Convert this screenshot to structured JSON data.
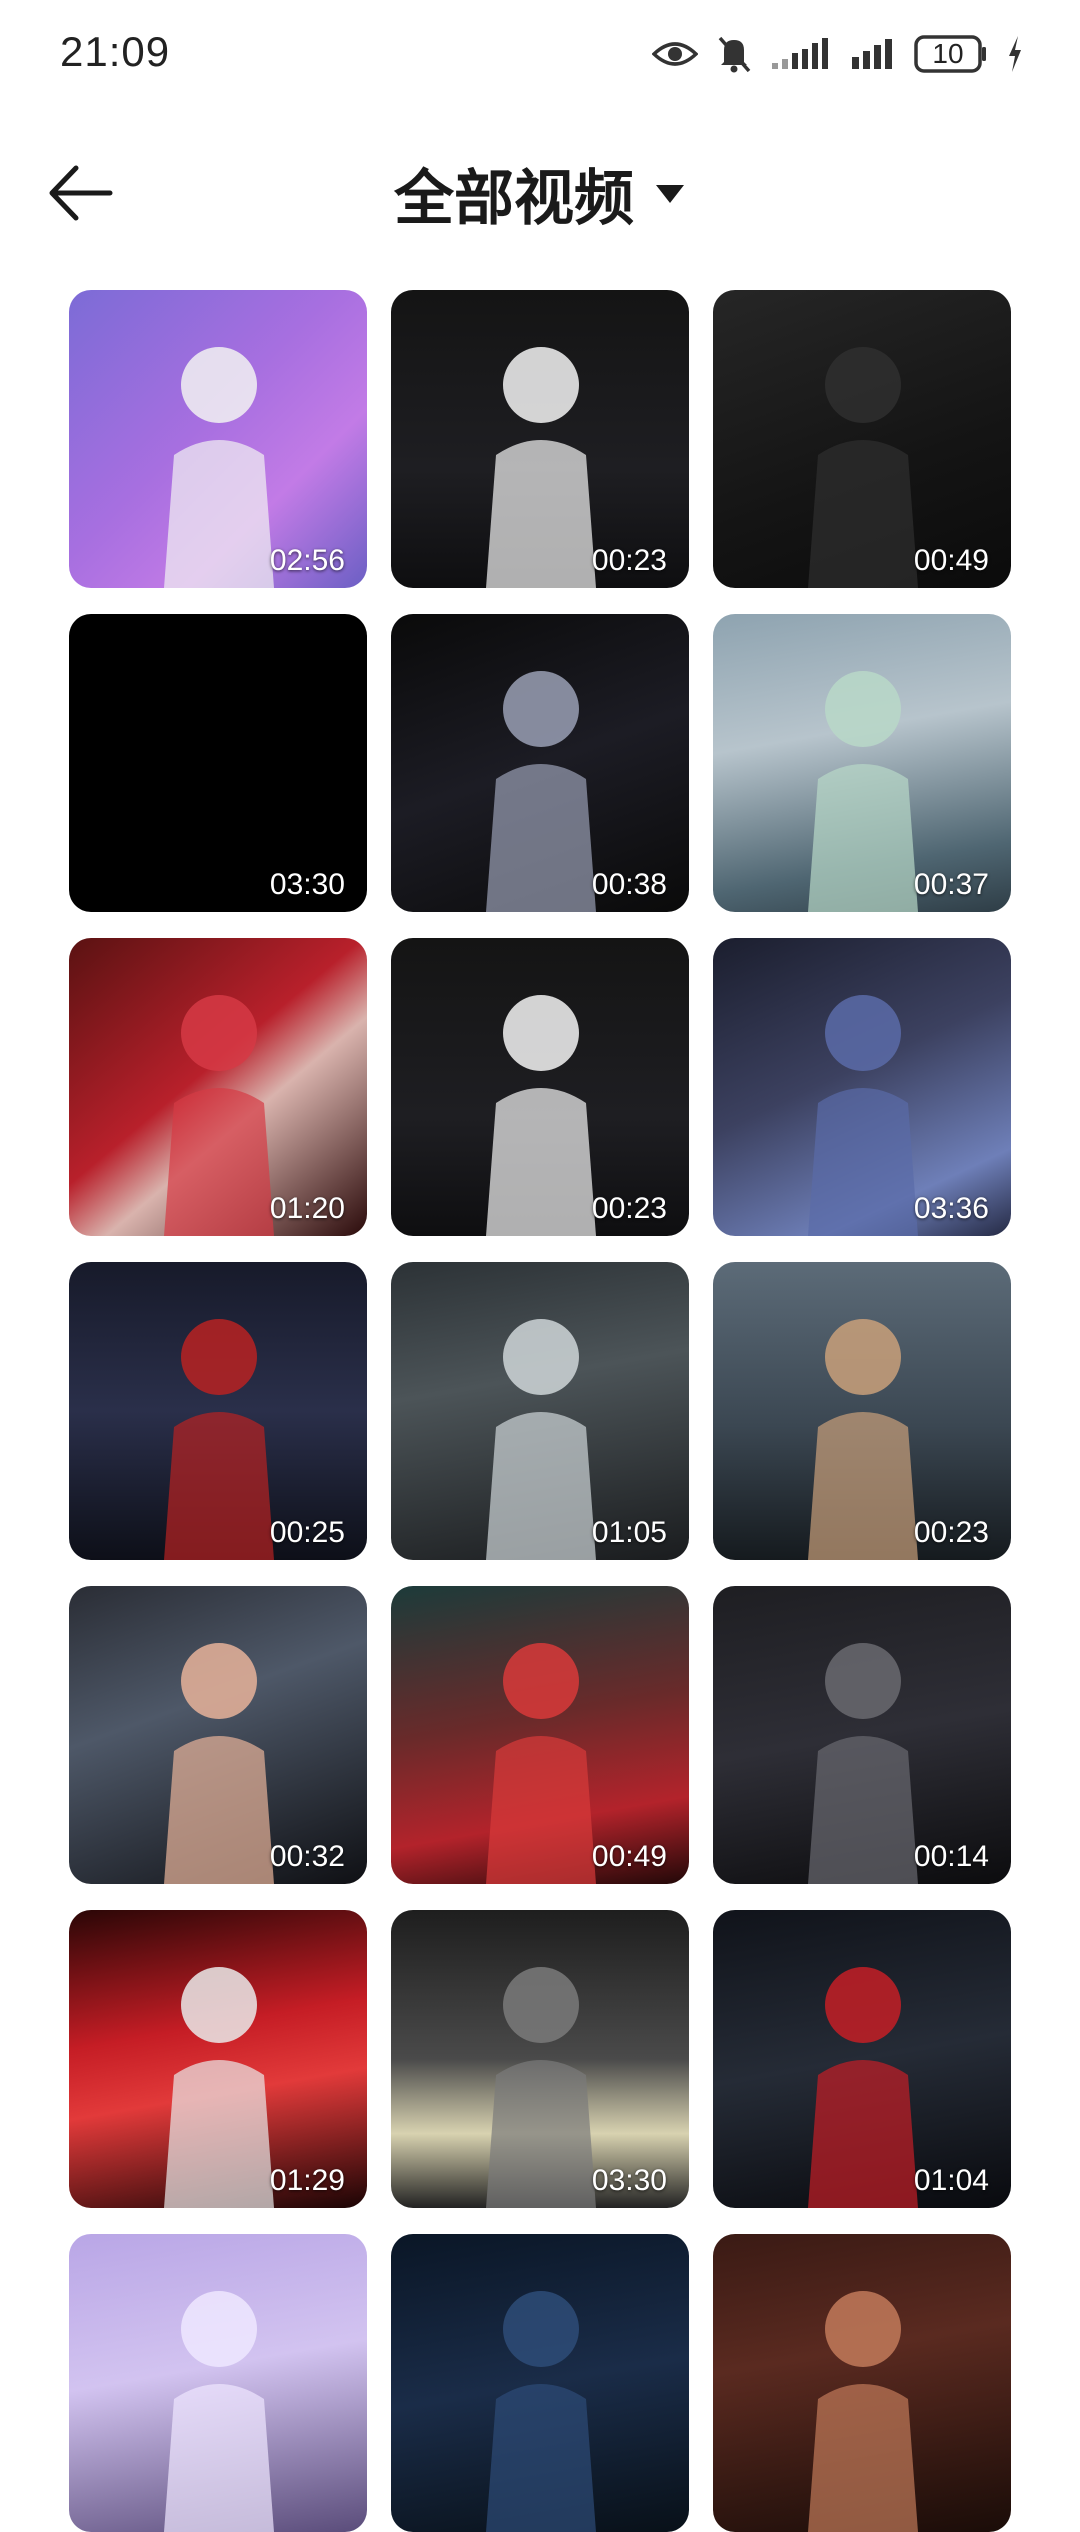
{
  "status_bar": {
    "time": "21:09",
    "battery": "10",
    "icons": [
      "eye-icon",
      "mute-icon",
      "signal-icon",
      "signal-icon",
      "battery-icon",
      "charging-icon"
    ]
  },
  "header": {
    "title": "全部视频",
    "back_icon": "back-arrow-icon",
    "dropdown_icon": "caret-down-icon"
  },
  "videos": [
    {
      "duration": "02:56",
      "bg": "linear-gradient(135deg,#7c6bd6 0%,#a76fe0 45%,#c27be6 70%,#6b5fc4 100%)",
      "fig": "#f2f2f2"
    },
    {
      "duration": "00:23",
      "bg": "linear-gradient(180deg,#141414 0%,#1e1e22 60%,#0e0e10 100%)",
      "fig": "#f5f5f5"
    },
    {
      "duration": "00:49",
      "bg": "linear-gradient(160deg,#262626 0%,#141414 60%,#0b0b0b 100%)",
      "fig": "#2f2f2f"
    },
    {
      "duration": "03:30",
      "bg": "#000000",
      "fig": "#000000"
    },
    {
      "duration": "00:38",
      "bg": "linear-gradient(160deg,#0a0a0a 0%,#1c1c24 50%,#0a0a0a 100%)",
      "fig": "#9aa0b5"
    },
    {
      "duration": "00:37",
      "bg": "linear-gradient(170deg,#8ea3b0 0%,#b7c4cc 40%,#4f6672 80%,#2e3d46 100%)",
      "fig": "#b8d8c8"
    },
    {
      "duration": "01:20",
      "bg": "linear-gradient(140deg,#5a1212 0%,#b8202b 45%,#d9b3ad 60%,#2a0a0a 100%)",
      "fig": "#d63a45"
    },
    {
      "duration": "00:23",
      "bg": "linear-gradient(180deg,#141414 0%,#1e1e22 60%,#0e0e10 100%)",
      "fig": "#f5f5f5"
    },
    {
      "duration": "03:36",
      "bg": "linear-gradient(155deg,#1b1e2e 0%,#3c4160 45%,#6e7fb8 80%,#252a44 100%)",
      "fig": "#5a6ba8"
    },
    {
      "duration": "00:25",
      "bg": "linear-gradient(180deg,#171a2a 0%,#2a2f4a 50%,#0d0f18 100%)",
      "fig": "#b82222"
    },
    {
      "duration": "01:05",
      "bg": "linear-gradient(170deg,#2c3236 0%,#4c5458 40%,#1a1c1e 100%)",
      "fig": "#cfd6d8"
    },
    {
      "duration": "00:23",
      "bg": "linear-gradient(180deg,#5c6b78 0%,#3b4752 55%,#151a1e 100%)",
      "fig": "#c9a07a"
    },
    {
      "duration": "00:32",
      "bg": "linear-gradient(160deg,#2a2d35 0%,#4e5868 40%,#0f1014 100%)",
      "fig": "#e8b39a"
    },
    {
      "duration": "00:49",
      "bg": "linear-gradient(170deg,#1c3b3a 0%,#6a2a2a 45%,#b3232b 75%,#220808 100%)",
      "fig": "#d83a3a"
    },
    {
      "duration": "00:14",
      "bg": "linear-gradient(170deg,#1e1e22 0%,#2e2e36 50%,#0c0c0e 100%)",
      "fig": "#6a6a70"
    },
    {
      "duration": "01:29",
      "bg": "linear-gradient(170deg,#2a0606 0%,#c51d25 40%,#e23a3a 60%,#1a0404 100%)",
      "fig": "#eaeaea"
    },
    {
      "duration": "03:30",
      "bg": "linear-gradient(180deg,#1e1e1e 0%,#4a4a4a 50%,#d8d2b0 75%,#222 100%)",
      "fig": "#7a7a7a"
    },
    {
      "duration": "01:04",
      "bg": "linear-gradient(170deg,#10131a 0%,#252b36 50%,#090a0e 100%)",
      "fig": "#c41e26"
    },
    {
      "duration": "",
      "bg": "linear-gradient(170deg,#b9a6e6 0%,#d2c3f0 45%,#5a4c7a 100%)",
      "fig": "#efe7ff"
    },
    {
      "duration": "",
      "bg": "linear-gradient(170deg,#0a1626 0%,#1a2c48 50%,#081018 100%)",
      "fig": "#2e4c78"
    },
    {
      "duration": "",
      "bg": "linear-gradient(170deg,#3a1a14 0%,#5a2a20 40%,#1a0c08 100%)",
      "fig": "#c27a5a"
    }
  ]
}
